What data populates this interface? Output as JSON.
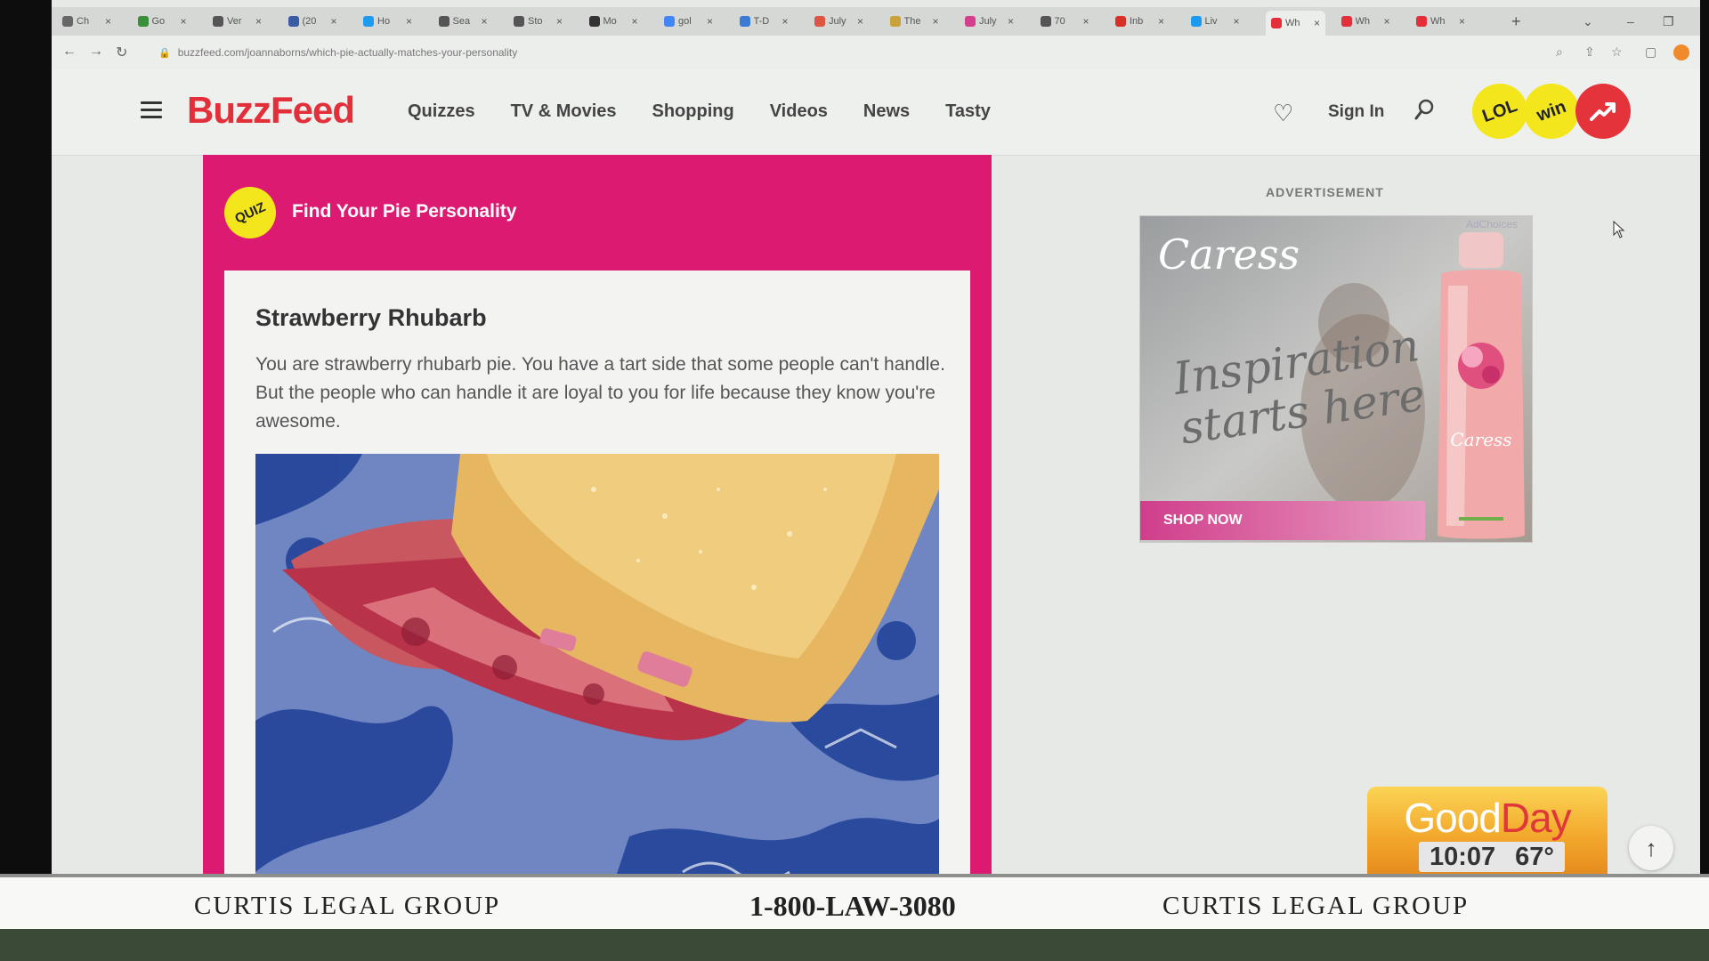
{
  "browser": {
    "tabs": [
      {
        "title": "Ch",
        "color": "#666"
      },
      {
        "title": "Go",
        "color": "#3a8f3a"
      },
      {
        "title": "Ver",
        "color": "#555"
      },
      {
        "title": "(20",
        "color": "#3b5ba8"
      },
      {
        "title": "Ho",
        "color": "#1d9bf0"
      },
      {
        "title": "Sea",
        "color": "#555"
      },
      {
        "title": "Sto",
        "color": "#555"
      },
      {
        "title": "Mo",
        "color": "#333"
      },
      {
        "title": "gol",
        "color": "#4285f4"
      },
      {
        "title": "T-D",
        "color": "#3a7bd5"
      },
      {
        "title": "July",
        "color": "#d54"
      },
      {
        "title": "The",
        "color": "#c9a23a"
      },
      {
        "title": "July",
        "color": "#d43f8d"
      },
      {
        "title": "70",
        "color": "#555"
      },
      {
        "title": "Inb",
        "color": "#d93025"
      },
      {
        "title": "Liv",
        "color": "#1d9bf0"
      },
      {
        "title": "Wh",
        "color": "#e32f3a"
      },
      {
        "title": "Wh",
        "color": "#e32f3a"
      },
      {
        "title": "Wh",
        "color": "#e32f3a"
      }
    ],
    "active_tab": 16,
    "new_tab": "+",
    "url": "buzzfeed.com/joannaborns/which-pie-actually-matches-your-personality"
  },
  "site": {
    "logo": "BuzzFeed",
    "logo_color": "#e32f3a",
    "nav": [
      "Quizzes",
      "TV & Movies",
      "Shopping",
      "Videos",
      "News",
      "Tasty"
    ],
    "sign_in": "Sign In",
    "badges": [
      "LOL",
      "win"
    ]
  },
  "quiz": {
    "badge": "QUIZ",
    "title": "Find Your Pie Personality",
    "accent": "#dc1a72",
    "result_title": "Strawberry Rhubarb",
    "result_text": "You are strawberry rhubarb pie. You have a tart side that some people can't handle. But the people who can handle it are loyal to you for life because they know you're awesome."
  },
  "ad": {
    "label": "ADVERTISEMENT",
    "brand": "Caress",
    "tagline": "Inspiration starts here",
    "choices": "AdChoices",
    "cta": "SHOP NOW"
  },
  "broadcast": {
    "show_good": "Good",
    "show_day": "Day",
    "time": "10:07",
    "temp": "67°",
    "sponsor_left": "CURTIS LEGAL GROUP",
    "sponsor_phone": "1-800-LAW-3080",
    "sponsor_right": "CURTIS LEGAL GROUP"
  }
}
